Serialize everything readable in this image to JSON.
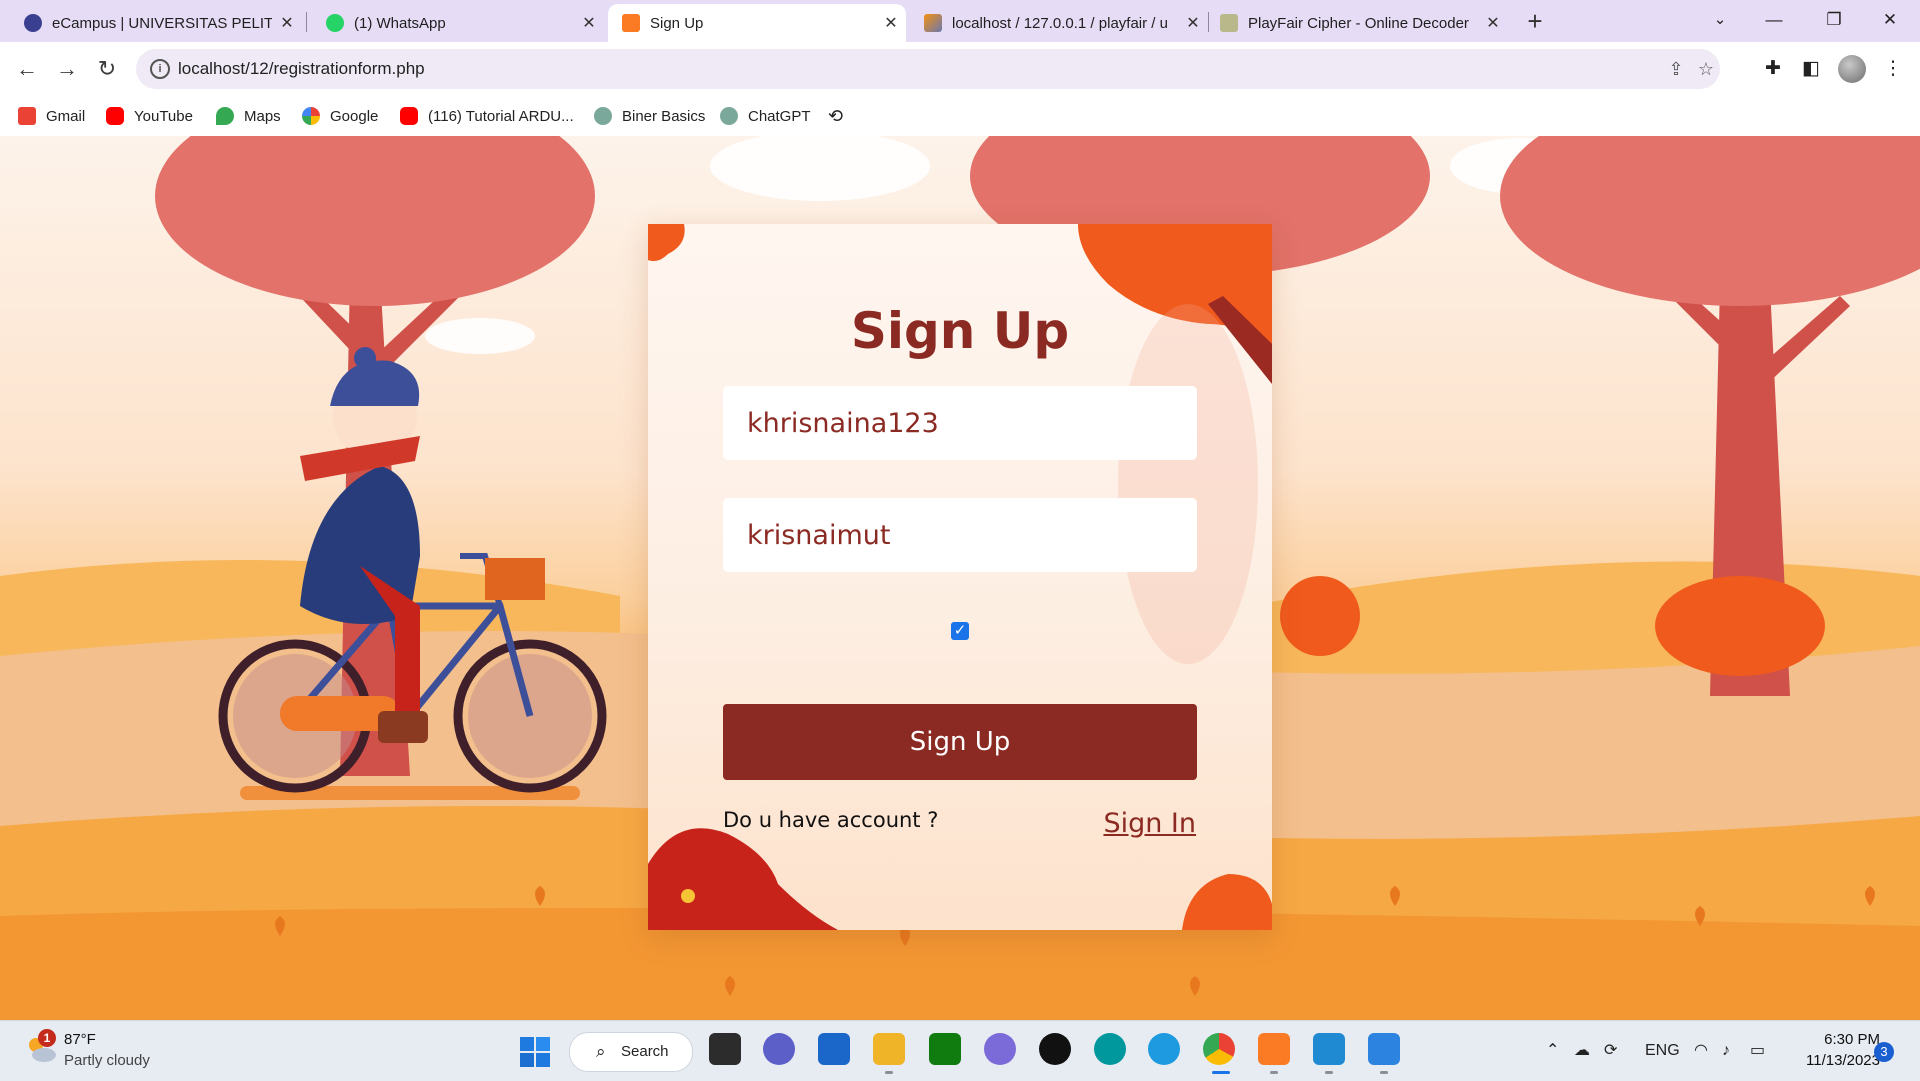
{
  "browser": {
    "tabs": [
      {
        "title": "eCampus | UNIVERSITAS PELITA",
        "icon": "ecampus-icon",
        "active": false
      },
      {
        "title": "(1) WhatsApp",
        "icon": "whatsapp-icon",
        "active": false
      },
      {
        "title": "Sign Up",
        "icon": "xampp-icon",
        "active": true
      },
      {
        "title": "localhost / 127.0.0.1 / playfair / u",
        "icon": "phpmyadmin-icon",
        "active": false
      },
      {
        "title": "PlayFair Cipher - Online Decoder",
        "icon": "dcode-icon",
        "active": false
      }
    ],
    "url": "localhost/12/registrationform.php",
    "bookmarks": [
      {
        "label": "Gmail",
        "icon": "gmail-icon",
        "color": "#ea4335"
      },
      {
        "label": "YouTube",
        "icon": "youtube-icon",
        "color": "#ff0000"
      },
      {
        "label": "Maps",
        "icon": "maps-icon",
        "color": "#34a853"
      },
      {
        "label": "Google",
        "icon": "google-icon",
        "color": "#4285f4"
      },
      {
        "label": "(116) Tutorial ARDU...",
        "icon": "youtube-icon",
        "color": "#ff0000"
      },
      {
        "label": "Biner Basics",
        "icon": "chatgpt-icon",
        "color": "#6b9e8f"
      },
      {
        "label": "ChatGPT",
        "icon": "chatgpt-icon",
        "color": "#6b9e8f"
      }
    ]
  },
  "form": {
    "title": "Sign Up",
    "username_value": "khrisnaina123",
    "password_value": "krisnaimut",
    "checkbox_checked": true,
    "submit_label": "Sign Up",
    "question_text": "Do u have account ?",
    "signin_link": "Sign In"
  },
  "taskbar": {
    "temperature": "87°F",
    "condition": "Partly cloudy",
    "weather_badge": "1",
    "search_label": "Search",
    "language": "ENG",
    "time": "6:30 PM",
    "date": "11/13/2023",
    "notification_count": "3"
  },
  "colors": {
    "brand": "#8b2a22",
    "tabstrip": "#e6dcf5",
    "card_bg": "#fff6f0"
  }
}
